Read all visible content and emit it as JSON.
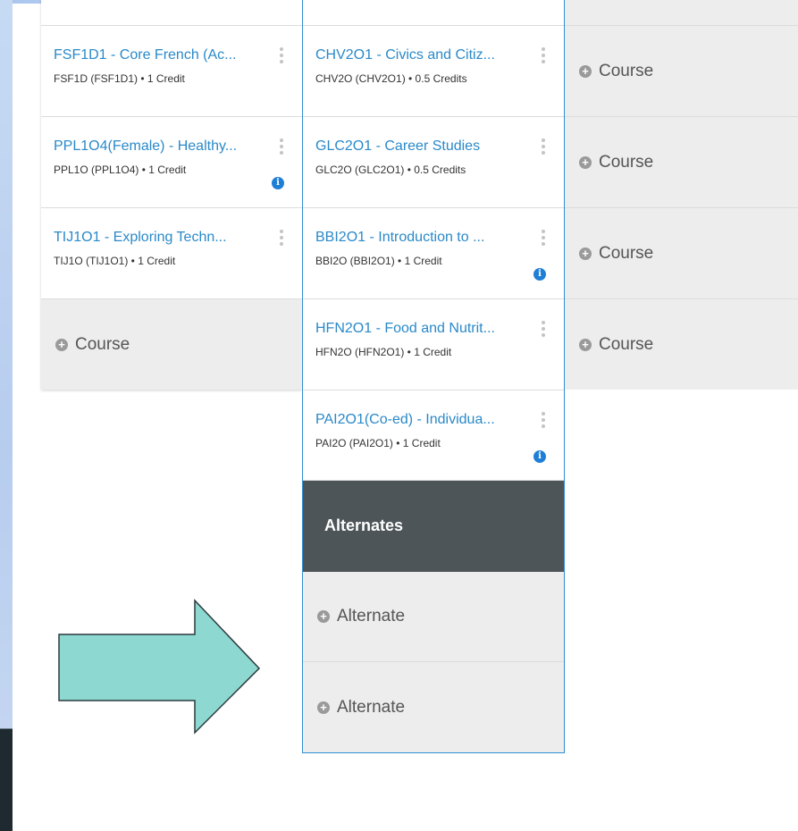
{
  "left_column": {
    "courses": [
      {
        "title": "FSF1D1 - Core French (Ac...",
        "code": "FSF1D (FSF1D1) • 1 Credit",
        "info": false
      },
      {
        "title": "PPL1O4(Female) - Healthy...",
        "code": "PPL1O (PPL1O4) • 1 Credit",
        "info": true
      },
      {
        "title": "TIJ1O1 - Exploring Techn...",
        "code": "TIJ1O (TIJ1O1) • 1 Credit",
        "info": false
      }
    ],
    "add_course_label": "Course"
  },
  "middle_column": {
    "courses": [
      {
        "title": "CHV2O1 - Civics and Citiz...",
        "code": "CHV2O (CHV2O1) • 0.5 Credits",
        "info": false
      },
      {
        "title": "GLC2O1 - Career Studies",
        "code": "GLC2O (GLC2O1) • 0.5 Credits",
        "info": false
      },
      {
        "title": "BBI2O1 - Introduction to ...",
        "code": "BBI2O (BBI2O1) • 1 Credit",
        "info": true
      },
      {
        "title": "HFN2O1 - Food and Nutrit...",
        "code": "HFN2O (HFN2O1) • 1 Credit",
        "info": false
      },
      {
        "title": "PAI2O1(Co-ed) - Individua...",
        "code": "PAI2O (PAI2O1) • 1 Credit",
        "info": true
      }
    ],
    "alternates_header": "Alternates",
    "alternate_slots": [
      "Alternate",
      "Alternate"
    ]
  },
  "right_column": {
    "slots": [
      "Course",
      "Course",
      "Course",
      "Course"
    ]
  },
  "info_glyph": "i",
  "plus_glyph": "+",
  "colors": {
    "link_blue": "#2a89c9",
    "selected_border": "#2f8fd3",
    "header_dark": "#4d5558",
    "empty_slot_bg": "#ededed",
    "arrow_fill": "#8ed8d2"
  }
}
